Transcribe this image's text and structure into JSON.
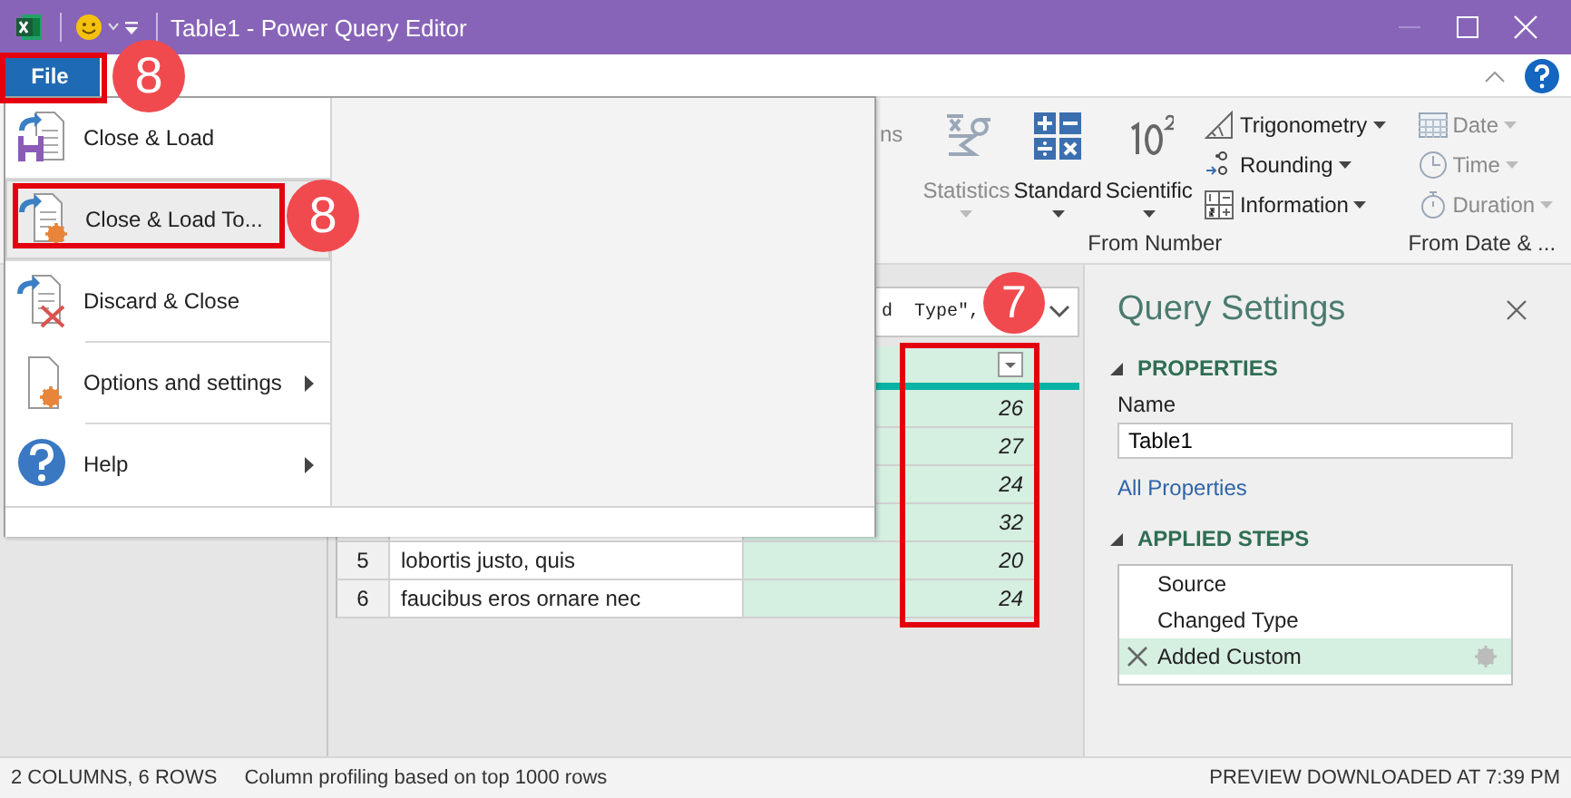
{
  "window": {
    "title": "Table1 - Power Query Editor"
  },
  "file_tab": {
    "label": "File"
  },
  "ribbon": {
    "cut_label": "ns",
    "groups": [
      {
        "label": "From Number",
        "buttons": [
          {
            "kind": "large",
            "label": "Statistics",
            "disabled": true
          },
          {
            "kind": "large",
            "label": "Standard",
            "disabled": false
          },
          {
            "kind": "large",
            "label": "Scientific",
            "disabled": false
          },
          {
            "kind": "small",
            "label": "Trigonometry",
            "disabled": false
          },
          {
            "kind": "small",
            "label": "Rounding",
            "disabled": false
          },
          {
            "kind": "small",
            "label": "Information",
            "disabled": false
          }
        ]
      },
      {
        "label": "From Date & ...",
        "buttons": [
          {
            "kind": "small",
            "label": "Date",
            "disabled": true
          },
          {
            "kind": "small",
            "label": "Time",
            "disabled": true
          },
          {
            "kind": "small",
            "label": "Duration",
            "disabled": true
          }
        ]
      }
    ]
  },
  "file_menu": {
    "items": [
      {
        "label": "Close & Load",
        "selected": false,
        "submenu": false
      },
      {
        "label": "Close & Load To...",
        "selected": true,
        "submenu": false
      },
      {
        "label": "Discard & Close",
        "selected": false,
        "submenu": false
      },
      {
        "label": "Options and settings",
        "selected": false,
        "submenu": true
      },
      {
        "label": "Help",
        "selected": false,
        "submenu": true
      }
    ]
  },
  "formula_bar": {
    "value": "d  Type\","
  },
  "table": {
    "rows": [
      {
        "value": "26"
      },
      {
        "value": "27"
      },
      {
        "value": "24"
      },
      {
        "value": "32"
      },
      {
        "number": "5",
        "text": "lobortis justo, quis",
        "value": "20"
      },
      {
        "number": "6",
        "text": "faucibus eros ornare nec",
        "value": "24"
      }
    ]
  },
  "query_settings": {
    "title": "Query Settings",
    "properties": {
      "heading": "PROPERTIES",
      "name_label": "Name",
      "name_value": "Table1",
      "link": "All Properties"
    },
    "applied_steps": {
      "heading": "APPLIED STEPS",
      "steps": [
        {
          "label": "Source",
          "selected": false
        },
        {
          "label": "Changed Type",
          "selected": false
        },
        {
          "label": "Added Custom",
          "selected": true
        }
      ]
    }
  },
  "status_bar": {
    "counts": "2 COLUMNS, 6 ROWS",
    "profiling": "Column profiling based on top 1000 rows",
    "preview": "PREVIEW DOWNLOADED AT 7:39 PM"
  },
  "annotations": [
    {
      "label": "8"
    },
    {
      "label": "8"
    },
    {
      "label": "7"
    }
  ]
}
